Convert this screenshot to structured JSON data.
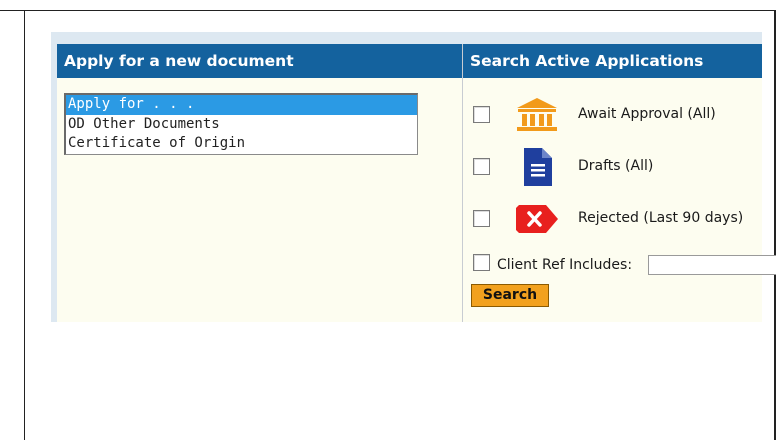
{
  "left_panel": {
    "title": "Apply for a new document",
    "options": [
      "Apply for . . .",
      "OD Other Documents",
      "Certificate of Origin"
    ],
    "selected_index": 0
  },
  "right_panel": {
    "title": "Search Active Applications",
    "filters": [
      {
        "label": "Await Approval (All)",
        "icon": "bank-icon",
        "color": "#f29a1a"
      },
      {
        "label": "Drafts (All)",
        "icon": "document-icon",
        "color": "#1f3f9e"
      },
      {
        "label": "Rejected (Last 90 days)",
        "icon": "rejected-icon",
        "color": "#e8201e"
      }
    ],
    "client_ref_label": "Client Ref Includes:",
    "client_ref_value": "",
    "search_label": "Search"
  },
  "colors": {
    "header": "#14629e",
    "panel": "#fdfdf0",
    "selected_option": "#2b9ae4",
    "search_button": "#f2a11e"
  }
}
